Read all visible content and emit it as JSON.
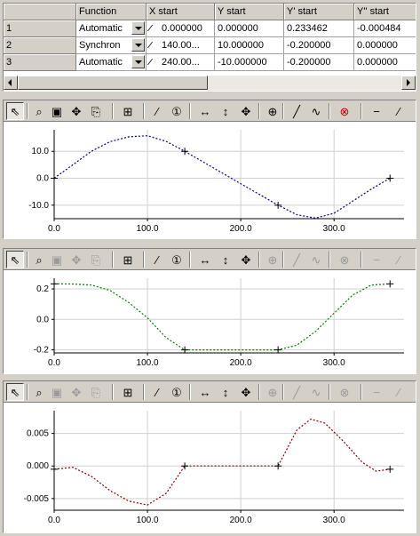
{
  "table": {
    "columns": [
      "Function",
      "X start",
      "Y start",
      "Y' start",
      "Y'' start"
    ],
    "rows": [
      {
        "num": "1",
        "function": "Automatic",
        "x_start": "0.000000",
        "y_start": "0.000000",
        "y1_start": "0.233462",
        "y2_start": "-0.000484"
      },
      {
        "num": "2",
        "function": "Synchron",
        "x_start": "140.00...",
        "y_start": "10.000000",
        "y1_start": "-0.200000",
        "y2_start": "0.000000"
      },
      {
        "num": "3",
        "function": "Automatic",
        "x_start": "240.00...",
        "y_start": "-10.000000",
        "y1_start": "-0.200000",
        "y2_start": "0.000000"
      }
    ]
  },
  "toolbar_icons": [
    "select-arrow-icon",
    "zoom-icon",
    "zoom-window-icon",
    "pan-icon",
    "copy-icon",
    "fit-grid-icon",
    "edit-points-icon",
    "one-icon",
    "horizontal-arrows-icon",
    "vertical-arrows-icon",
    "move-all-icon",
    "insert-point-icon",
    "line-tool-icon",
    "curve-tool-icon",
    "delete-icon",
    "hline-icon",
    "slash-icon"
  ],
  "chart_data": [
    {
      "type": "line",
      "xlim": [
        0,
        360
      ],
      "ylim": [
        -15,
        18
      ],
      "x_ticks": [
        "0.0",
        "100.0",
        "200.0",
        "300.0"
      ],
      "y_ticks": [
        "-10.0",
        "0.0",
        "10.0"
      ],
      "color": "#000080",
      "points": [
        [
          0,
          0
        ],
        [
          20,
          5
        ],
        [
          40,
          10
        ],
        [
          60,
          13.6
        ],
        [
          80,
          15.4
        ],
        [
          100,
          15.8
        ],
        [
          120,
          13.7
        ],
        [
          140,
          10
        ],
        [
          160,
          6
        ],
        [
          180,
          2
        ],
        [
          200,
          -2
        ],
        [
          220,
          -6
        ],
        [
          240,
          -10
        ],
        [
          260,
          -13.5
        ],
        [
          280,
          -14.8
        ],
        [
          300,
          -13
        ],
        [
          320,
          -8.5
        ],
        [
          340,
          -4
        ],
        [
          360,
          0
        ]
      ],
      "markers": [
        [
          0,
          0
        ],
        [
          140,
          10
        ],
        [
          240,
          -10
        ],
        [
          360,
          0
        ]
      ],
      "grid": true
    },
    {
      "type": "line",
      "xlim": [
        0,
        360
      ],
      "ylim": [
        -0.22,
        0.27
      ],
      "x_ticks": [
        "0.0",
        "100.0",
        "200.0",
        "300.0"
      ],
      "y_ticks": [
        "-0.2",
        "0.0",
        "0.2"
      ],
      "color": "#008000",
      "points": [
        [
          0,
          0.233
        ],
        [
          20,
          0.232
        ],
        [
          40,
          0.225
        ],
        [
          60,
          0.19
        ],
        [
          80,
          0.11
        ],
        [
          100,
          0.01
        ],
        [
          120,
          -0.12
        ],
        [
          140,
          -0.2
        ],
        [
          160,
          -0.2
        ],
        [
          200,
          -0.2
        ],
        [
          240,
          -0.2
        ],
        [
          260,
          -0.17
        ],
        [
          280,
          -0.08
        ],
        [
          300,
          0.04
        ],
        [
          320,
          0.16
        ],
        [
          340,
          0.225
        ],
        [
          360,
          0.233
        ]
      ],
      "markers": [
        [
          0,
          0.233
        ],
        [
          140,
          -0.2
        ],
        [
          240,
          -0.2
        ],
        [
          360,
          0.233
        ]
      ],
      "grid": true
    },
    {
      "type": "line",
      "xlim": [
        0,
        360
      ],
      "ylim": [
        -0.0068,
        0.0085
      ],
      "x_ticks": [
        "0.0",
        "100.0",
        "200.0",
        "300.0"
      ],
      "y_ticks": [
        "-0.005",
        "0.000",
        "0.005"
      ],
      "color": "#800000",
      "points": [
        [
          0,
          -0.0005
        ],
        [
          20,
          -0.0002
        ],
        [
          40,
          -0.0016
        ],
        [
          60,
          -0.0038
        ],
        [
          80,
          -0.0054
        ],
        [
          100,
          -0.006
        ],
        [
          120,
          -0.0042
        ],
        [
          140,
          0
        ],
        [
          160,
          0
        ],
        [
          200,
          0
        ],
        [
          240,
          0
        ],
        [
          260,
          0.0055
        ],
        [
          275,
          0.0072
        ],
        [
          290,
          0.0066
        ],
        [
          310,
          0.0038
        ],
        [
          330,
          0.0006
        ],
        [
          345,
          -0.0008
        ],
        [
          360,
          -0.0005
        ]
      ],
      "markers": [
        [
          0,
          -0.0005
        ],
        [
          140,
          0
        ],
        [
          240,
          0
        ],
        [
          360,
          -0.0005
        ]
      ],
      "grid": true
    }
  ]
}
